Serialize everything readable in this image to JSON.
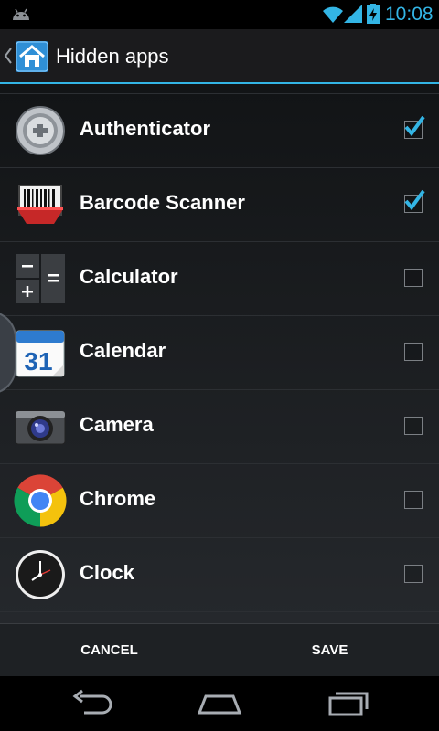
{
  "status_bar": {
    "time": "10:08",
    "accent": "#33b5e5"
  },
  "action_bar": {
    "title": "Hidden apps",
    "up_icon": "chevron-left-icon",
    "app_icon": "home-icon"
  },
  "apps": [
    {
      "label": "Authenticator",
      "checked": true,
      "icon": "authenticator-icon"
    },
    {
      "label": "Barcode Scanner",
      "checked": true,
      "icon": "barcode-scanner-icon"
    },
    {
      "label": "Calculator",
      "checked": false,
      "icon": "calculator-icon"
    },
    {
      "label": "Calendar",
      "checked": false,
      "icon": "calendar-icon"
    },
    {
      "label": "Camera",
      "checked": false,
      "icon": "camera-icon"
    },
    {
      "label": "Chrome",
      "checked": false,
      "icon": "chrome-icon"
    },
    {
      "label": "Clock",
      "checked": false,
      "icon": "clock-icon"
    }
  ],
  "calendar_icon_text": "31",
  "buttons": {
    "cancel": "CANCEL",
    "save": "SAVE"
  },
  "nav": {
    "back": "back-icon",
    "home": "home-nav-icon",
    "recent": "recent-apps-icon"
  }
}
